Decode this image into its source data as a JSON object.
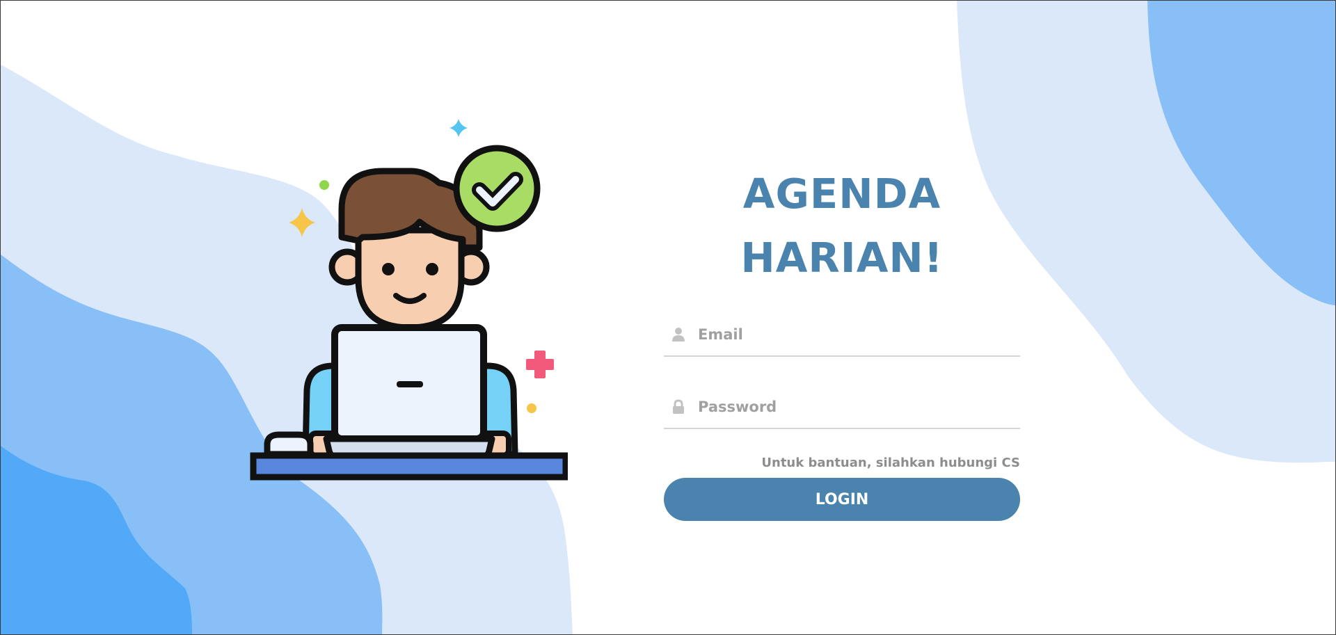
{
  "page": {
    "title": "AGENDA HARIAN!"
  },
  "form": {
    "email": {
      "placeholder": "Email",
      "value": "",
      "icon": "user-icon"
    },
    "password": {
      "placeholder": "Password",
      "value": "",
      "icon": "lock-icon"
    },
    "help_text": "Untuk bantuan, silahkan hubungi CS",
    "login_label": "LOGIN"
  },
  "colors": {
    "accent": "#4a83ad",
    "wave_light": "#dbe8fa",
    "wave_mid": "#89bff7",
    "wave_dark": "#52a9f7",
    "placeholder": "#a0a0a0",
    "underline": "#d5d5d5"
  }
}
